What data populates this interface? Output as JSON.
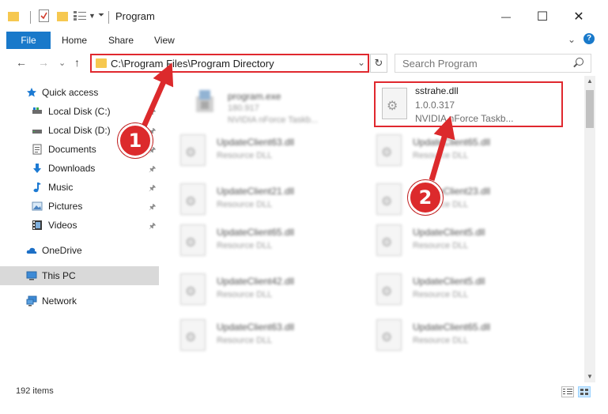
{
  "window": {
    "title": "Program",
    "minimize_glyph": "—",
    "maximize_glyph": "☐",
    "close_glyph": "✕"
  },
  "ribbon": {
    "tabs": [
      "File",
      "Home",
      "Share",
      "View"
    ],
    "expand_glyph": "⌄",
    "help_glyph": "?"
  },
  "nav": {
    "back_glyph": "←",
    "forward_glyph": "→",
    "recent_glyph": "⌄",
    "up_glyph": "↑"
  },
  "address": {
    "path": "C:\\Program Files\\Program Directory",
    "chevron": "⌄",
    "refresh_glyph": "↻"
  },
  "search": {
    "placeholder": "Search Program"
  },
  "sidebar": {
    "items": [
      {
        "label": "Quick access",
        "icon": "star-icon"
      },
      {
        "label": "Local Disk (C:)",
        "icon": "drive-icon",
        "pinned": true
      },
      {
        "label": "Local Disk (D:)",
        "icon": "drive-icon",
        "pinned": true
      },
      {
        "label": "Documents",
        "icon": "documents-icon",
        "pinned": true
      },
      {
        "label": "Downloads",
        "icon": "downloads-icon",
        "pinned": true
      },
      {
        "label": "Music",
        "icon": "music-icon",
        "pinned": true
      },
      {
        "label": "Pictures",
        "icon": "pictures-icon",
        "pinned": true
      },
      {
        "label": "Videos",
        "icon": "videos-icon",
        "pinned": true
      },
      {
        "label": "OneDrive",
        "icon": "cloud-icon"
      },
      {
        "label": "This PC",
        "icon": "computer-icon",
        "selected": true
      },
      {
        "label": "Network",
        "icon": "network-icon"
      }
    ],
    "pin_glyph": "📌"
  },
  "files": [
    {
      "name": "program.exe",
      "line2": "180.917",
      "line3": "NVIDIA nForce Taskb..."
    },
    {
      "name": "sstrahe.dll",
      "line2": "1.0.0.317",
      "line3": "NVIDIA nForce Taskb..."
    },
    {
      "name": "UpdateClient63.dll",
      "line2": "Resource DLL"
    },
    {
      "name": "UpdateClient65.dll",
      "line2": "Resource DLL"
    },
    {
      "name": "UpdateClient21.dll",
      "line2": "Resource DLL"
    },
    {
      "name": "UpdateClient23.dll",
      "line2": "Resource DLL"
    },
    {
      "name": "UpdateClient65.dll",
      "line2": "Resource DLL"
    },
    {
      "name": "UpdateClient5.dll",
      "line2": "Resource DLL"
    },
    {
      "name": "UpdateClient42.dll",
      "line2": "Resource DLL"
    },
    {
      "name": "UpdateClient5.dll",
      "line2": "Resource DLL"
    },
    {
      "name": "UpdateClient63.dll",
      "line2": "Resource DLL"
    },
    {
      "name": "UpdateClient65.dll",
      "line2": "Resource DLL"
    }
  ],
  "status": {
    "item_count": "192 items"
  },
  "annotations": {
    "badge1": "1",
    "badge2": "2",
    "color": "#dc2a2c"
  }
}
